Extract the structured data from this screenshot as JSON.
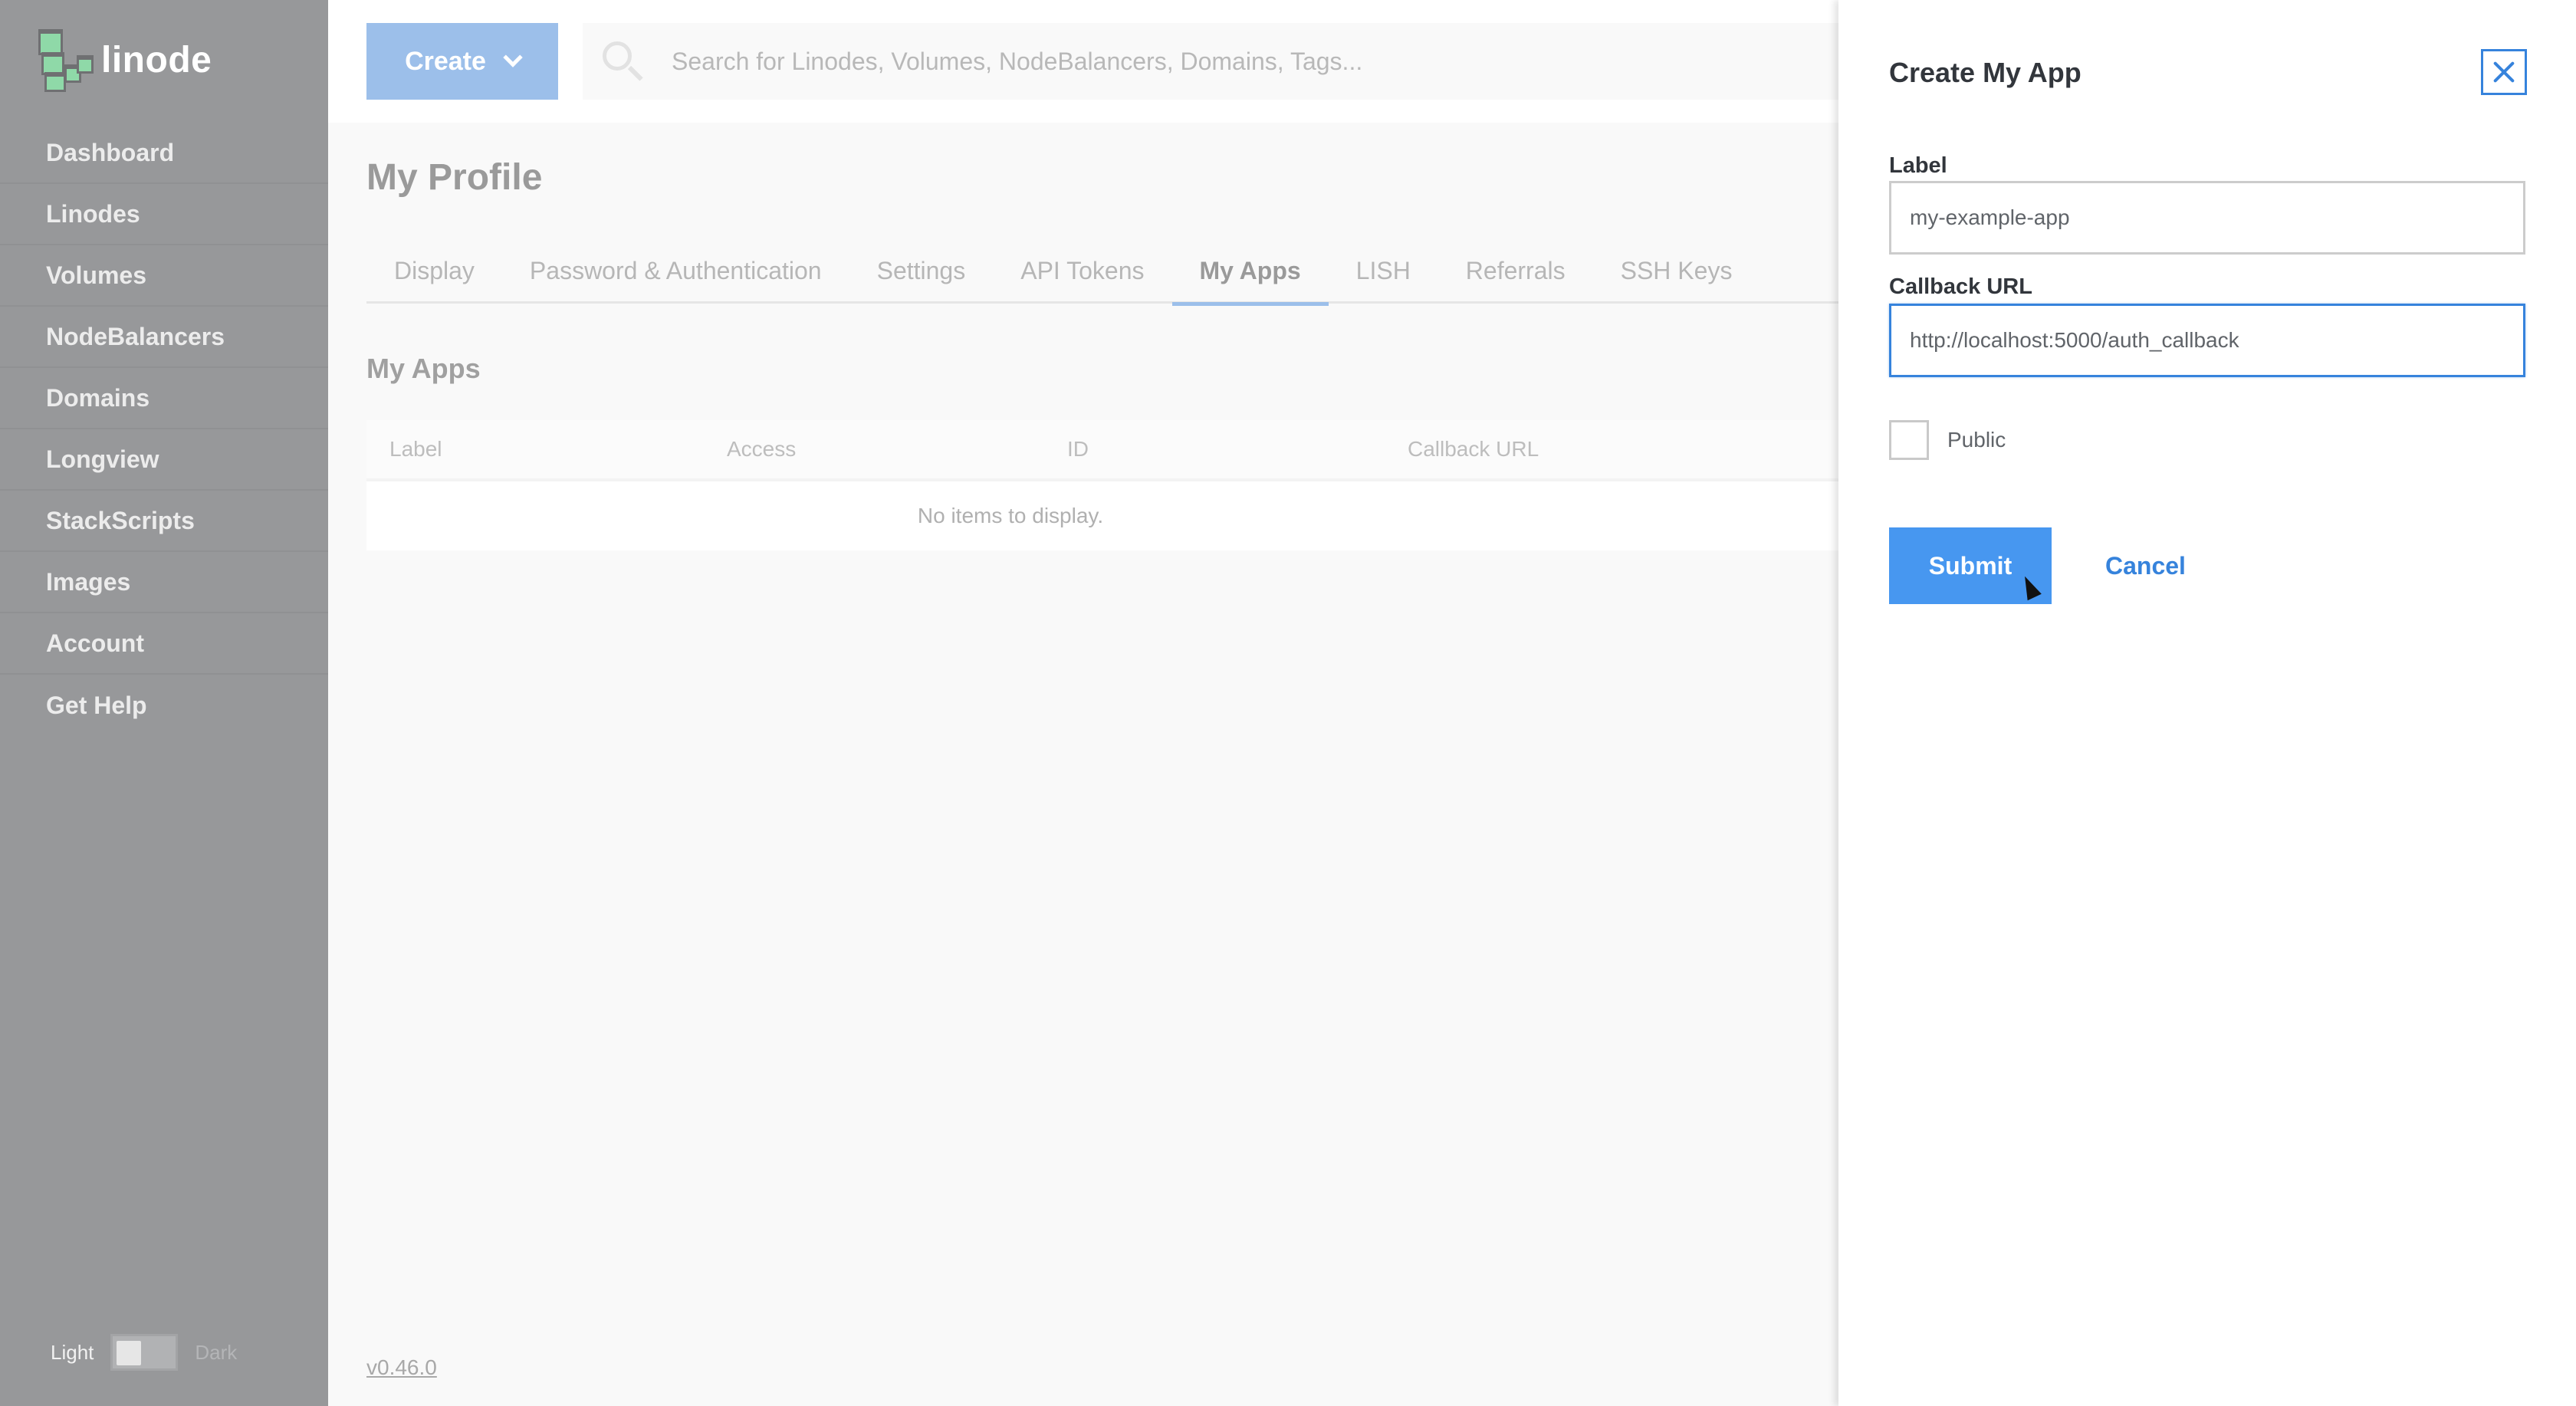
{
  "brand": {
    "name": "linode",
    "logo_icon": "linode-cubes-icon"
  },
  "sidebar": {
    "items": [
      {
        "label": "Dashboard"
      },
      {
        "label": "Linodes"
      },
      {
        "label": "Volumes"
      },
      {
        "label": "NodeBalancers"
      },
      {
        "label": "Domains"
      },
      {
        "label": "Longview"
      },
      {
        "label": "StackScripts"
      },
      {
        "label": "Images"
      },
      {
        "label": "Account"
      },
      {
        "label": "Get Help"
      }
    ],
    "theme_toggle": {
      "light_label": "Light",
      "dark_label": "Dark",
      "selected": "Light"
    }
  },
  "topbar": {
    "create_label": "Create",
    "search_placeholder": "Search for Linodes, Volumes, NodeBalancers, Domains, Tags..."
  },
  "main": {
    "page_title": "My Profile",
    "tabs": [
      {
        "label": "Display",
        "active": false
      },
      {
        "label": "Password & Authentication",
        "active": false
      },
      {
        "label": "Settings",
        "active": false
      },
      {
        "label": "API Tokens",
        "active": false
      },
      {
        "label": "My Apps",
        "active": true
      },
      {
        "label": "LISH",
        "active": false
      },
      {
        "label": "Referrals",
        "active": false
      },
      {
        "label": "SSH Keys",
        "active": false
      }
    ],
    "section_title": "My Apps",
    "table": {
      "columns": [
        "Label",
        "Access",
        "ID",
        "Callback URL"
      ],
      "empty_message": "No items to display."
    },
    "version": "v0.46.0"
  },
  "drawer": {
    "title": "Create My App",
    "close_icon": "close-icon",
    "label_field": {
      "label": "Label",
      "value": "my-example-app"
    },
    "callback_field": {
      "label": "Callback URL",
      "value": "http://localhost:5000/auth_callback"
    },
    "public_checkbox": {
      "label": "Public",
      "checked": false
    },
    "submit_label": "Submit",
    "cancel_label": "Cancel"
  },
  "colors": {
    "accent": "#3683dc",
    "submit": "#4797f0",
    "sidebar_bg": "#97989a",
    "create_button_dimmed": "#9cbfea"
  }
}
